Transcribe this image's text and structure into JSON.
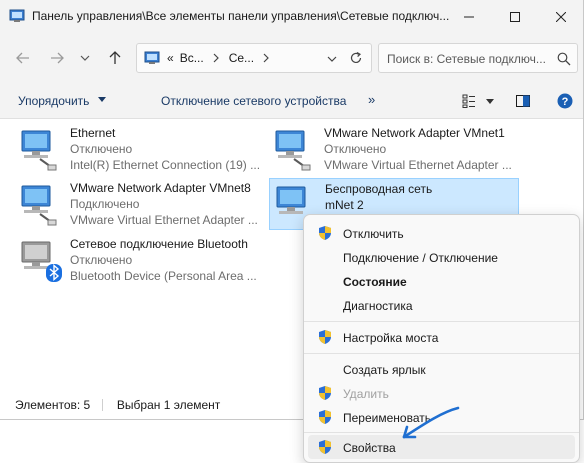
{
  "window": {
    "title": "Панель управления\\Все элементы панели управления\\Сетевые подключ..."
  },
  "address": {
    "chevrons": "«",
    "segment1": "Вс...",
    "segment2": "Се...",
    "search_placeholder": "Поиск в: Сетевые подключ..."
  },
  "commands": {
    "organize": "Упорядочить",
    "disable_device": "Отключение сетевого устройства",
    "more": "»"
  },
  "items": [
    {
      "name": "Ethernet",
      "status": "Отключено",
      "device": "Intel(R) Ethernet Connection (19) ..."
    },
    {
      "name": "VMware Network Adapter VMnet1",
      "status": "Отключено",
      "device": "VMware Virtual Ethernet Adapter ..."
    },
    {
      "name": "VMware Network Adapter VMnet8",
      "status": "Подключено",
      "device": "VMware Virtual Ethernet Adapter ..."
    },
    {
      "name": "Беспроводная сеть",
      "status": "mNet 2",
      "device": ""
    },
    {
      "name": "Сетевое подключение Bluetooth",
      "status": "Отключено",
      "device": "Bluetooth Device (Personal Area ..."
    }
  ],
  "statusbar": {
    "count": "Элементов: 5",
    "selected": "Выбран 1 элемент"
  },
  "context_menu": {
    "disable": "Отключить",
    "connect_disconnect": "Подключение / Отключение",
    "status": "Состояние",
    "diagnostics": "Диагностика",
    "bridge": "Настройка моста",
    "shortcut": "Создать ярлык",
    "delete": "Удалить",
    "rename": "Переименовать",
    "properties": "Свойства"
  },
  "colors": {
    "accent_arrow": "#1f6fd1",
    "selection_bg": "#cce8ff",
    "selection_border": "#99d1ff"
  }
}
